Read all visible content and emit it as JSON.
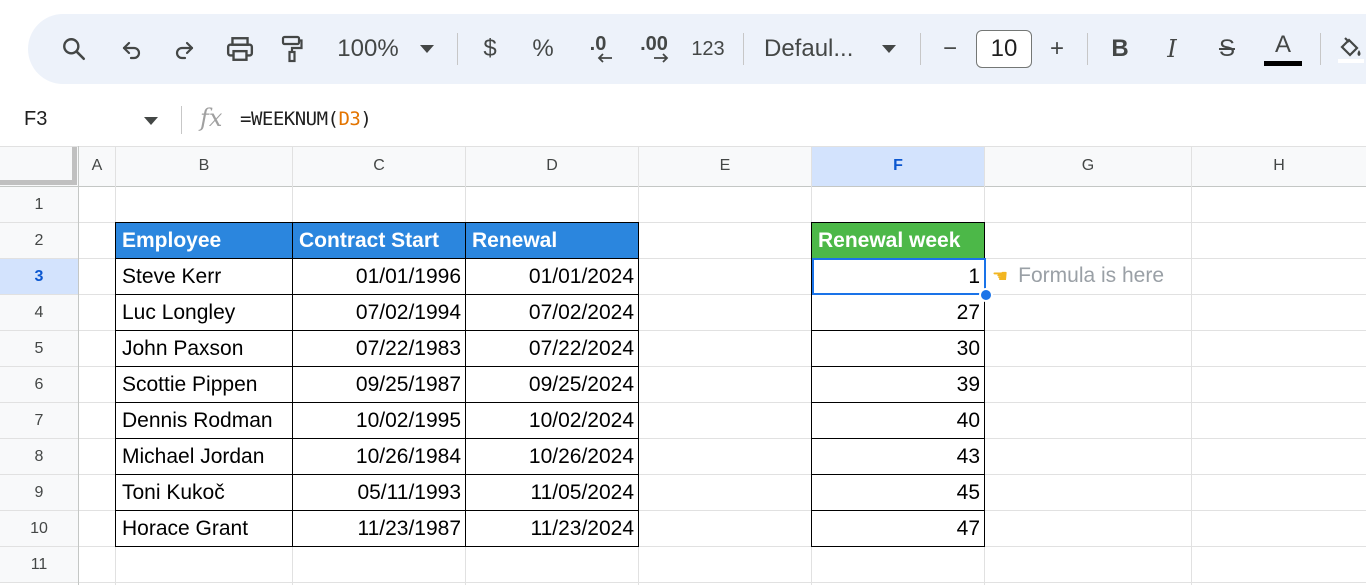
{
  "toolbar": {
    "zoom": "100%",
    "currency": "$",
    "percent": "%",
    "decrease_decimal": ".0",
    "increase_decimal": ".00",
    "number_format": "123",
    "font": "Defaul...",
    "font_size": "10",
    "minus": "−",
    "plus": "+",
    "bold": "B",
    "italic": "I",
    "strike": "S",
    "text_color": "A"
  },
  "formula_bar": {
    "name_box": "F3",
    "fx": "fx",
    "formula_prefix": "=WEEKNUM(",
    "formula_ref": "D3",
    "formula_suffix": ")"
  },
  "columns": [
    "A",
    "B",
    "C",
    "D",
    "E",
    "F",
    "G",
    "H"
  ],
  "rows": [
    "1",
    "2",
    "3",
    "4",
    "5",
    "6",
    "7",
    "8",
    "9",
    "10",
    "11"
  ],
  "table": {
    "headers": [
      "Employee",
      "Contract Start",
      "Renewal"
    ],
    "rows": [
      [
        "Steve Kerr",
        "01/01/1996",
        "01/01/2024"
      ],
      [
        "Luc Longley",
        "07/02/1994",
        "07/02/2024"
      ],
      [
        "John Paxson",
        "07/22/1983",
        "07/22/2024"
      ],
      [
        "Scottie Pippen",
        "09/25/1987",
        "09/25/2024"
      ],
      [
        "Dennis Rodman",
        "10/02/1995",
        "10/02/2024"
      ],
      [
        "Michael Jordan",
        "10/26/1984",
        "10/26/2024"
      ],
      [
        "Toni Kukoč",
        "05/11/1993",
        "11/05/2024"
      ],
      [
        "Horace Grant",
        "11/23/1987",
        "11/23/2024"
      ]
    ]
  },
  "week_table": {
    "header": "Renewal week",
    "values": [
      "1",
      "27",
      "30",
      "39",
      "40",
      "43",
      "45",
      "47"
    ]
  },
  "note": {
    "icon": "pointing-hand-icon",
    "icon_glyph": "☚",
    "text": "Formula is here"
  },
  "colors": {
    "header_blue": "#2b86de",
    "header_green": "#4cb848",
    "selection": "#1a73e8"
  }
}
